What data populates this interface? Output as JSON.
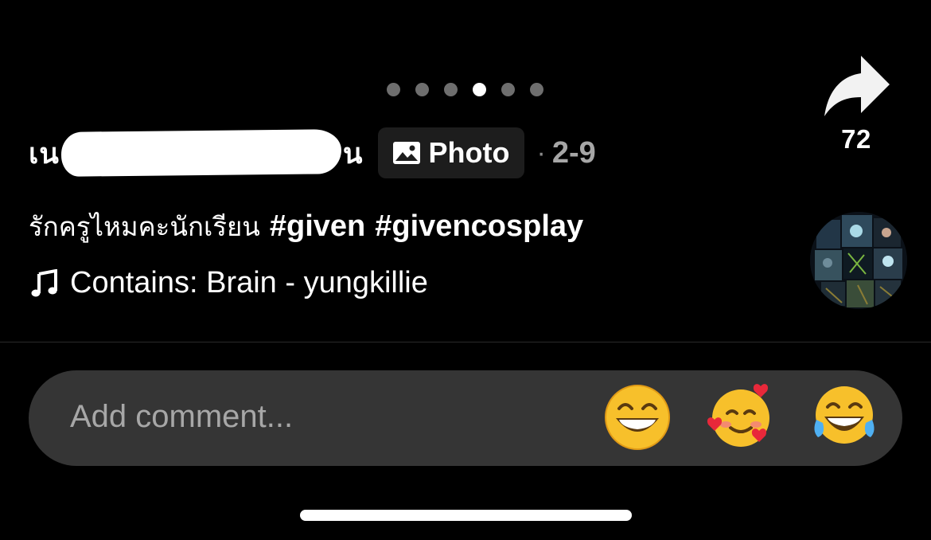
{
  "carousel": {
    "total": 6,
    "active_index": 3
  },
  "share": {
    "icon": "share-arrow-icon",
    "count": "72"
  },
  "author": {
    "name_start": "เน",
    "name_end": "น",
    "name_redacted": true
  },
  "post_type": {
    "icon": "photo-icon",
    "label": "Photo"
  },
  "meta": {
    "separator": "·",
    "date": "2-9"
  },
  "caption": {
    "text": "รักครูไหมคะนักเรียน",
    "hashtags": [
      "#given",
      "#givencosplay"
    ]
  },
  "music": {
    "icon": "music-note-icon",
    "text": "Contains: Brain - yungkillie"
  },
  "comment": {
    "placeholder": "Add comment...",
    "emojis": [
      "grinning-face-icon",
      "smiling-face-with-hearts-icon",
      "face-with-tears-of-joy-icon"
    ]
  },
  "colors": {
    "background": "#000000",
    "comment_bar": "#353535",
    "inactive_dot": "#6e6e6e",
    "badge_bg": "#1d1d1d"
  }
}
